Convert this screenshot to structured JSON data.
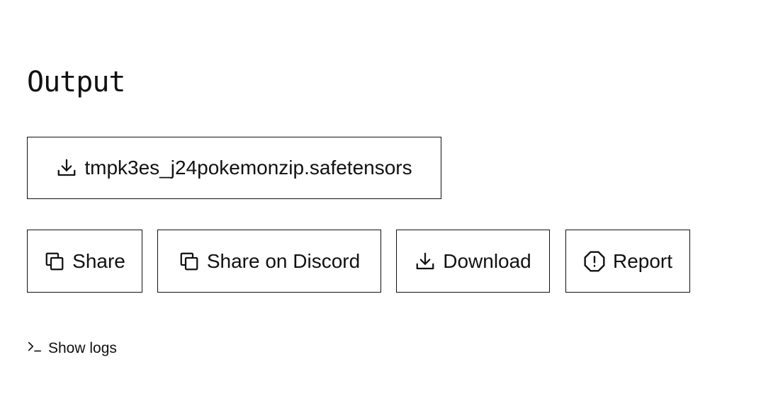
{
  "output": {
    "title": "Output",
    "file_label": "tmpk3es_j24pokemonzip.safetensors"
  },
  "actions": {
    "share": {
      "label": "Share",
      "icon": "copy-icon"
    },
    "discord": {
      "label": "Share on Discord",
      "icon": "copy-icon"
    },
    "download": {
      "label": "Download",
      "icon": "download-icon"
    },
    "report": {
      "label": "Report",
      "icon": "alert-octagon-icon"
    }
  },
  "logs": {
    "label": "Show logs",
    "icon": "terminal-icon"
  }
}
